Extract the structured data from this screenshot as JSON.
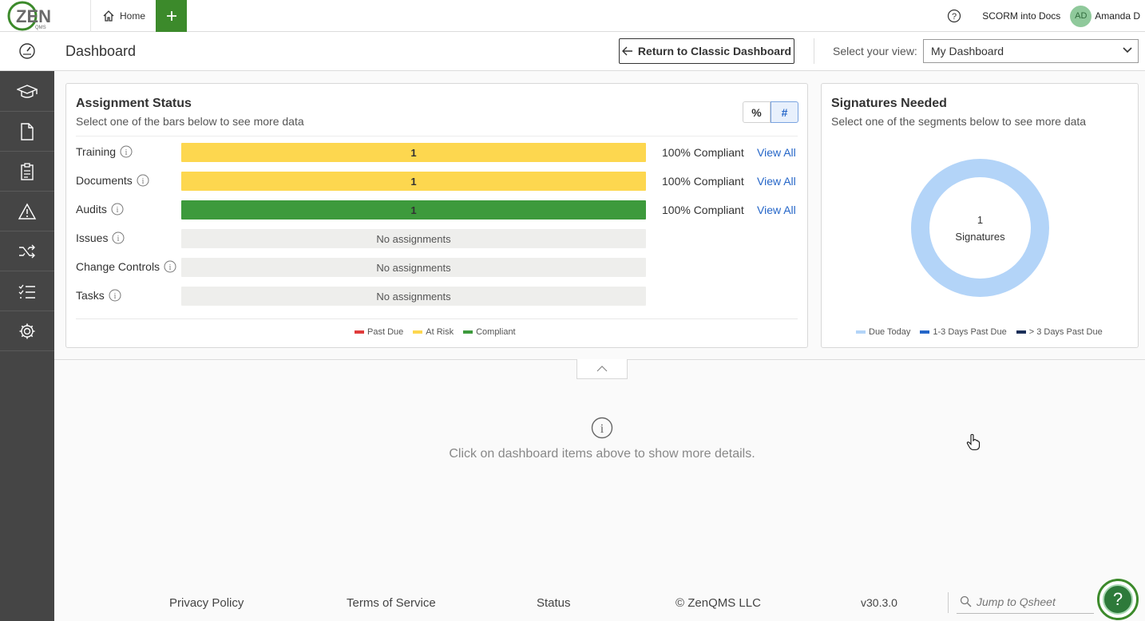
{
  "brand": {
    "logo_text": "ZEN",
    "logo_sub": "QMS",
    "accent": "#3c8a2b"
  },
  "topbar": {
    "home_label": "Home",
    "project_label": "SCORM into Docs",
    "user_initials": "AD",
    "user_name": "Amanda D"
  },
  "header": {
    "title": "Dashboard",
    "classic_button": "Return to Classic Dashboard",
    "view_label": "Select your view:",
    "view_selected": "My Dashboard"
  },
  "sidebar": {
    "items": [
      "dashboard",
      "training",
      "documents",
      "audits",
      "issues",
      "change-controls",
      "tasks",
      "settings"
    ]
  },
  "assignment_status": {
    "title": "Assignment Status",
    "subtitle": "Select one of the bars below to see more data",
    "toggle": {
      "percent": "%",
      "count": "#",
      "selected": "#"
    },
    "rows": [
      {
        "label": "Training",
        "value": "1",
        "status": "at-risk",
        "color": "#fdd74f",
        "compliance": "100% Compliant",
        "link": "View All"
      },
      {
        "label": "Documents",
        "value": "1",
        "status": "at-risk",
        "color": "#fdd74f",
        "compliance": "100% Compliant",
        "link": "View All"
      },
      {
        "label": "Audits",
        "value": "1",
        "status": "compliant",
        "color": "#3d9a3c",
        "compliance": "100% Compliant",
        "link": "View All"
      },
      {
        "label": "Issues",
        "value": "No assignments"
      },
      {
        "label": "Change Controls",
        "value": "No assignments"
      },
      {
        "label": "Tasks",
        "value": "No assignments"
      }
    ],
    "legend": [
      {
        "label": "Past Due",
        "color": "#e03b3b"
      },
      {
        "label": "At Risk",
        "color": "#fdd74f"
      },
      {
        "label": "Compliant",
        "color": "#3d9a3c"
      }
    ]
  },
  "signatures": {
    "title": "Signatures Needed",
    "subtitle": "Select one of the segments below to see more data",
    "count": "1",
    "count_label": "Signatures",
    "segments": [
      {
        "label": "Due Today",
        "value": 1,
        "color": "#b3d4f8"
      }
    ],
    "legend": [
      {
        "label": "Due Today",
        "color": "#b3d4f8"
      },
      {
        "label": "1-3 Days Past Due",
        "color": "#2566c8"
      },
      {
        "label": "> 3 Days Past Due",
        "color": "#1b2f59"
      }
    ]
  },
  "details": {
    "message": "Click on dashboard items above to show more details."
  },
  "footer": {
    "privacy": "Privacy Policy",
    "terms": "Terms of Service",
    "status": "Status",
    "copyright": "© ZenQMS LLC",
    "version": "v30.3.0",
    "jump_placeholder": "Jump to Qsheet",
    "help_label": "?"
  }
}
